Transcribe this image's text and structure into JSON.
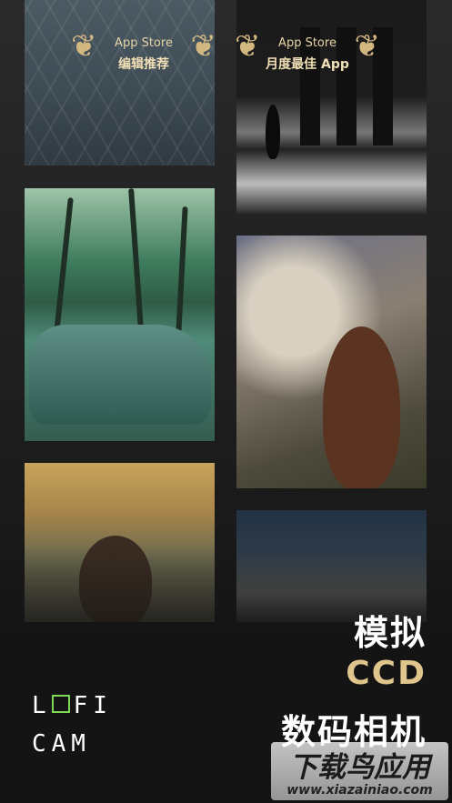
{
  "awards": [
    {
      "store": "App Store",
      "title": "编辑推荐"
    },
    {
      "store": "App Store",
      "title": "月度最佳 App"
    }
  ],
  "headline": {
    "line1": "模拟",
    "line2": "CCD",
    "line3": "数码相机"
  },
  "logo": {
    "line1_a": "L",
    "line1_b": "FI",
    "line2": "CAM"
  },
  "watermark": {
    "brand": "下载鸟应用",
    "url": "www.xiazainiao.com"
  },
  "colors": {
    "gold": "#e0c58c",
    "logo_focus": "#7ed957"
  }
}
